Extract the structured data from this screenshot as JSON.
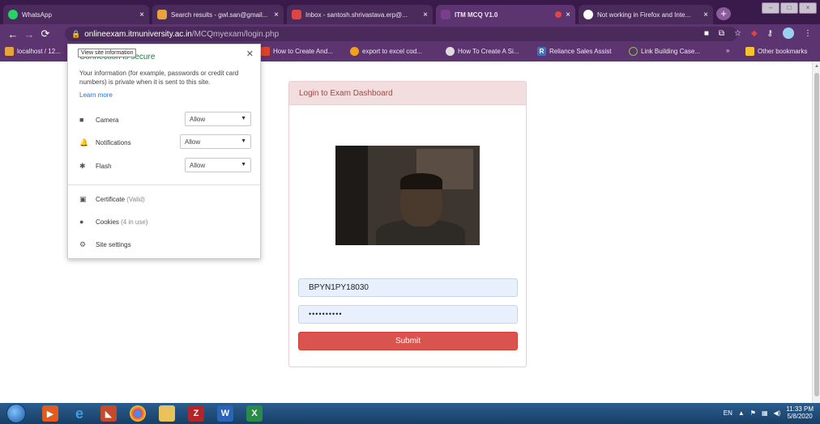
{
  "tabs": [
    {
      "title": "WhatsApp",
      "favicon_color": "#25d366"
    },
    {
      "title": "Search results - gwl.san@gmail...",
      "favicon_color": "#e8a33c"
    },
    {
      "title": "Inbox - santosh.shrivastava.erp@...",
      "favicon_color": "#e04545"
    },
    {
      "title": "ITM MCQ V1.0",
      "favicon_color": "#7a3e8c"
    },
    {
      "title": "Not working in Firefox and Inte...",
      "favicon_color": "#ffffff"
    }
  ],
  "toolbar": {
    "url_host": "onlineexam.itmuniversity.ac.in",
    "url_path": "/MCQmyexam/login.php"
  },
  "bookmarks": [
    {
      "label": "localhost / 12...",
      "icon_color": "#e8a33c"
    },
    {
      "label": "How to Create And...",
      "icon_color": "#d9442b"
    },
    {
      "label": "export to excel cod...",
      "icon_color": "#f0a21c"
    },
    {
      "label": "How To Create A Si...",
      "icon_color": "#dddddd"
    },
    {
      "label": "Reliance Sales Assist",
      "icon_color": "#3f6fb5"
    },
    {
      "label": "Link Building Case...",
      "icon_color": "#8bc34a"
    },
    {
      "label": "Other bookmarks",
      "icon_color": "#f6c231"
    }
  ],
  "popup": {
    "tooltip": "View site information",
    "title": "Connection is secure",
    "description": "Your information (for example, passwords or credit card numbers) is private when it is sent to this site.",
    "learn_more": "Learn more",
    "permissions": [
      {
        "label": "Camera",
        "value": "Allow"
      },
      {
        "label": "Notifications",
        "value": "Allow"
      },
      {
        "label": "Flash",
        "value": "Allow"
      }
    ],
    "certificate_label": "Certificate",
    "certificate_status": "(Valid)",
    "cookies_label": "Cookies",
    "cookies_status": "(4 in use)",
    "site_settings": "Site settings"
  },
  "login": {
    "heading": "Login to Exam Dashboard",
    "username_value": "BPYN1PY18030",
    "password_mask": "••••••••••",
    "submit_label": "Submit"
  },
  "taskbar": {
    "language": "EN",
    "time": "11:33 PM",
    "date": "5/8/2020"
  },
  "colors": {
    "chrome_theme": "#5c3470",
    "panel_heading_bg": "#f2dede",
    "panel_heading_text": "#a94442",
    "submit_bg": "#d9534f",
    "secure_text": "#1a7a3a"
  }
}
